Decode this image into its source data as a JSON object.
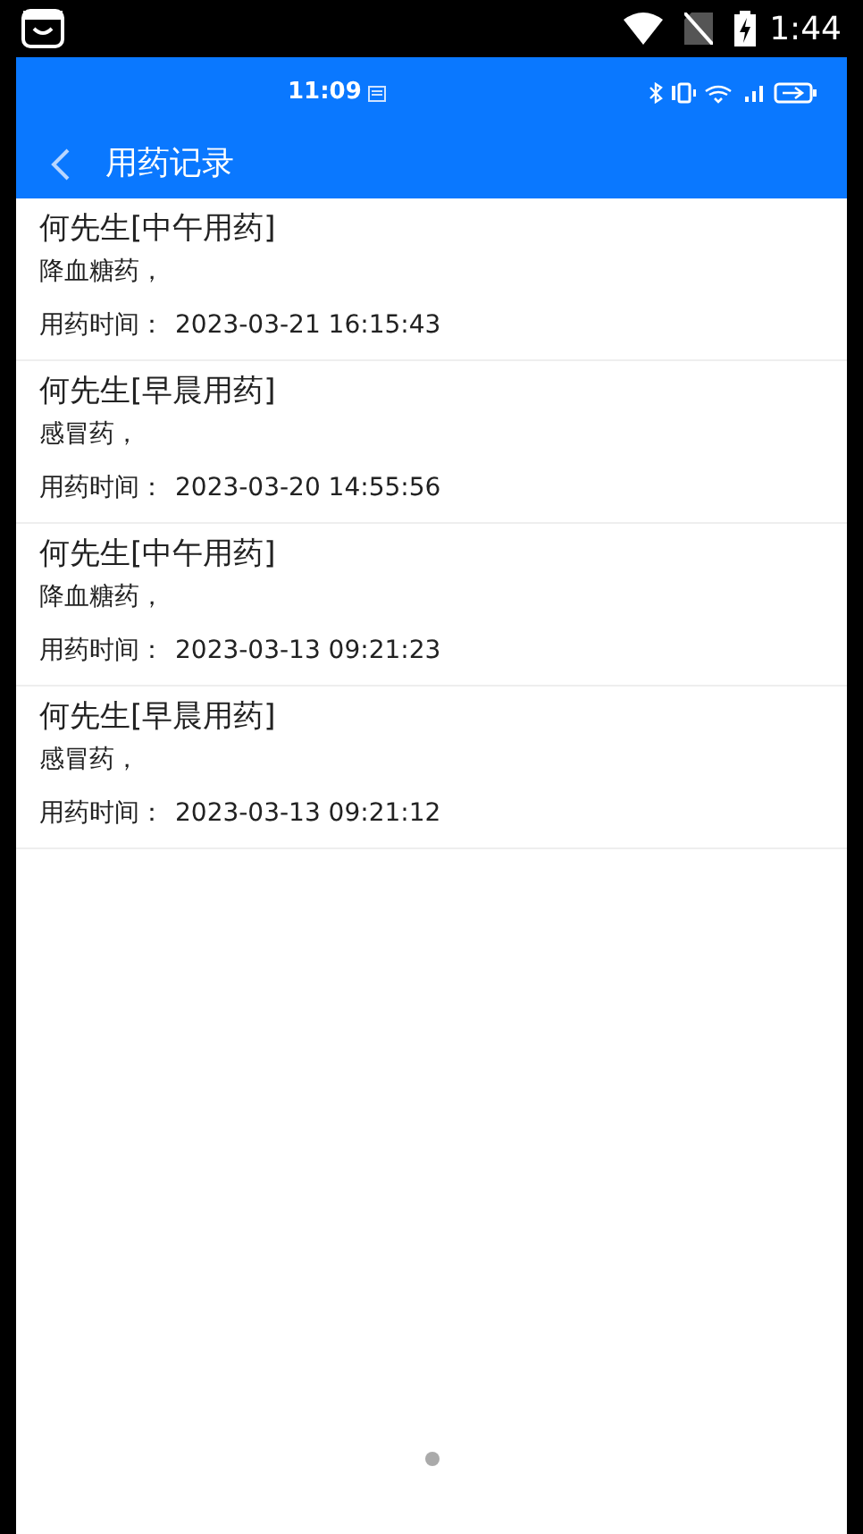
{
  "system_status": {
    "time": "1:44"
  },
  "inner_status": {
    "time": "11:09"
  },
  "header": {
    "title": "用药记录"
  },
  "records": [
    {
      "title": "何先生[中午用药]",
      "medicine": "降血糖药，",
      "time_label": "用药时间：",
      "time": "2023-03-21 16:15:43"
    },
    {
      "title": "何先生[早晨用药]",
      "medicine": "感冒药，",
      "time_label": "用药时间：",
      "time": "2023-03-20 14:55:56"
    },
    {
      "title": "何先生[中午用药]",
      "medicine": "降血糖药，",
      "time_label": "用药时间：",
      "time": "2023-03-13 09:21:23"
    },
    {
      "title": "何先生[早晨用药]",
      "medicine": "感冒药，",
      "time_label": "用药时间：",
      "time": "2023-03-13 09:21:12"
    }
  ]
}
